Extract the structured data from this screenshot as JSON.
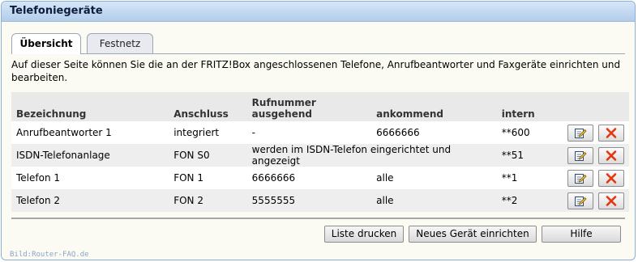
{
  "window": {
    "title": "Telefoniegeräte"
  },
  "tabs": [
    {
      "label": "Übersicht",
      "active": true
    },
    {
      "label": "Festnetz",
      "active": false
    }
  ],
  "description": "Auf dieser Seite können Sie die an der FRITZ!Box angeschlossenen Telefone, Anrufbeantworter und Faxgeräte einrichten und bearbeiten.",
  "table": {
    "headers": {
      "bezeichnung": "Bezeichnung",
      "anschluss": "Anschluss",
      "rufnummer": "Rufnummer",
      "ausgehend": "ausgehend",
      "ankommend": "ankommend",
      "intern": "intern"
    },
    "rows": [
      {
        "name": "Anrufbeantworter 1",
        "anschluss": "integriert",
        "ausgehend": "-",
        "ankommend": "6666666",
        "intern": "**600"
      },
      {
        "name": "ISDN-Telefonanlage",
        "anschluss": "FON S0",
        "note": "werden im ISDN-Telefon eingerichtet und angezeigt",
        "intern": "**51"
      },
      {
        "name": "Telefon 1",
        "anschluss": "FON 1",
        "ausgehend": "6666666",
        "ankommend": "alle",
        "intern": "**1"
      },
      {
        "name": "Telefon 2",
        "anschluss": "FON 2",
        "ausgehend": "5555555",
        "ankommend": "alle",
        "intern": "**2"
      }
    ],
    "row_icons": [
      "edit-icon",
      "delete-icon"
    ]
  },
  "buttons": {
    "print": "Liste drucken",
    "new_device": "Neues Gerät einrichten",
    "help": "Hilfe"
  },
  "credit": "Bild:Router-FAQ.de",
  "colors": {
    "delete": "#e8340c",
    "title_bar": "#c4daf2"
  }
}
